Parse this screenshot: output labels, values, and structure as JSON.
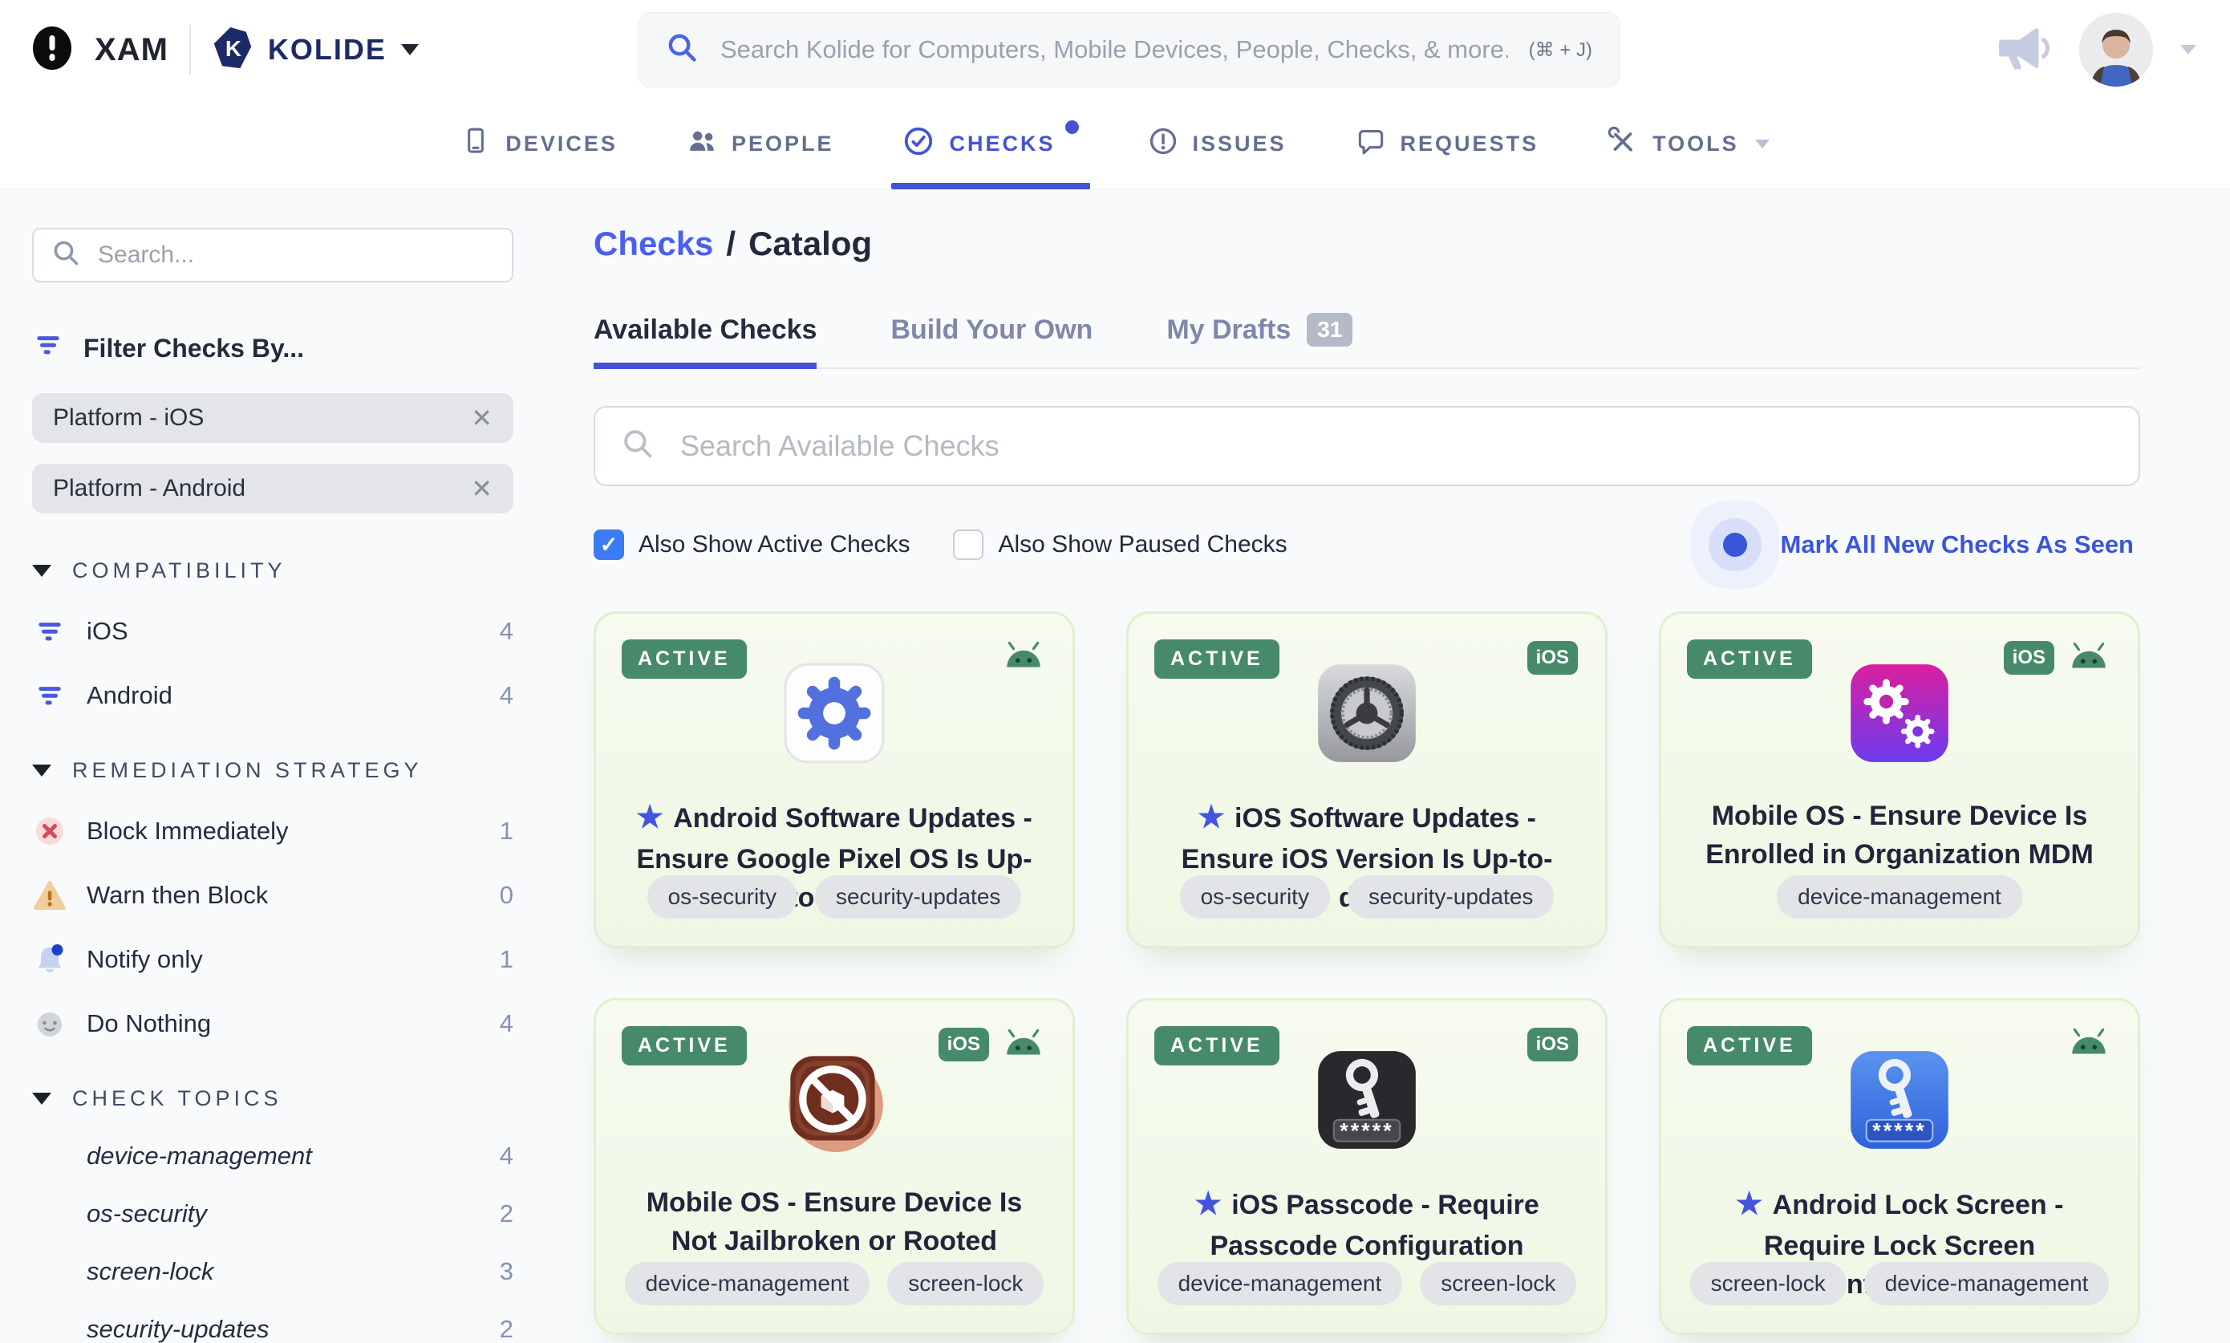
{
  "header": {
    "org": "XAM",
    "brand": "KOLIDE",
    "search_placeholder": "Search Kolide for Computers, Mobile Devices, People, Checks, & more...",
    "search_shortcut": "(⌘ + J)"
  },
  "nav": {
    "items": [
      {
        "label": "DEVICES",
        "icon": "devices",
        "active": false
      },
      {
        "label": "PEOPLE",
        "icon": "people",
        "active": false
      },
      {
        "label": "CHECKS",
        "icon": "checks",
        "active": true,
        "dot": true
      },
      {
        "label": "ISSUES",
        "icon": "issues",
        "active": false
      },
      {
        "label": "REQUESTS",
        "icon": "requests",
        "active": false
      },
      {
        "label": "TOOLS",
        "icon": "tools",
        "active": false,
        "caret": true
      }
    ]
  },
  "sidebar": {
    "search_placeholder": "Search...",
    "filter_title": "Filter Checks By...",
    "chips": [
      {
        "label": "Platform - iOS"
      },
      {
        "label": "Platform - Android"
      }
    ],
    "sections": [
      {
        "title": "COMPATIBILITY",
        "items": [
          {
            "label": "iOS",
            "count": "4",
            "icon": "filter"
          },
          {
            "label": "Android",
            "count": "4",
            "icon": "filter"
          }
        ]
      },
      {
        "title": "REMEDIATION STRATEGY",
        "items": [
          {
            "label": "Block Immediately",
            "count": "1",
            "icon": "block"
          },
          {
            "label": "Warn then Block",
            "count": "0",
            "icon": "warn"
          },
          {
            "label": "Notify only",
            "count": "1",
            "icon": "notify"
          },
          {
            "label": "Do Nothing",
            "count": "4",
            "icon": "nothing"
          }
        ]
      },
      {
        "title": "CHECK TOPICS",
        "items": [
          {
            "label": "device-management",
            "count": "4",
            "italic": true
          },
          {
            "label": "os-security",
            "count": "2",
            "italic": true
          },
          {
            "label": "screen-lock",
            "count": "3",
            "italic": true
          },
          {
            "label": "security-updates",
            "count": "2",
            "italic": true
          }
        ]
      }
    ]
  },
  "main": {
    "breadcrumb": {
      "parent": "Checks",
      "separator": "/",
      "current": "Catalog"
    },
    "tabs": [
      {
        "label": "Available Checks",
        "active": true
      },
      {
        "label": "Build Your Own",
        "active": false
      },
      {
        "label": "My Drafts",
        "active": false,
        "badge": "31"
      }
    ],
    "search_placeholder": "Search Available Checks",
    "filters": [
      {
        "label": "Also Show Active Checks",
        "checked": true
      },
      {
        "label": "Also Show Paused Checks",
        "checked": false
      }
    ],
    "mark_all_label": "Mark All New Checks As Seen",
    "cards": [
      {
        "status": "ACTIVE",
        "platforms": [
          "android"
        ],
        "icon": "android-gear",
        "starred": true,
        "title": "Android Software Updates - Ensure Google Pixel OS Is Up-to-date",
        "tags": [
          "os-security",
          "security-updates"
        ]
      },
      {
        "status": "ACTIVE",
        "platforms": [
          "ios"
        ],
        "icon": "ios-settings",
        "starred": true,
        "title": "iOS Software Updates - Ensure iOS Version Is Up-to-date",
        "tags": [
          "os-security",
          "security-updates"
        ]
      },
      {
        "status": "ACTIVE",
        "platforms": [
          "ios",
          "android"
        ],
        "icon": "mdm-gears",
        "starred": false,
        "title": "Mobile OS - Ensure Device Is Enrolled in Organization MDM",
        "tags": [
          "device-management"
        ]
      },
      {
        "status": "ACTIVE",
        "platforms": [
          "ios",
          "android"
        ],
        "icon": "no-jailbreak",
        "starred": false,
        "title": "Mobile OS - Ensure Device Is Not Jailbroken or Rooted",
        "tags": [
          "device-management",
          "screen-lock"
        ]
      },
      {
        "status": "ACTIVE",
        "platforms": [
          "ios"
        ],
        "icon": "passcode-dark",
        "starred": true,
        "title": "iOS Passcode - Require Passcode Configuration",
        "tags": [
          "device-management",
          "screen-lock"
        ]
      },
      {
        "status": "ACTIVE",
        "platforms": [
          "android"
        ],
        "icon": "passcode-blue",
        "starred": true,
        "title": "Android Lock Screen - Require Lock Screen Configuration",
        "tags": [
          "screen-lock",
          "device-management"
        ]
      }
    ]
  },
  "colors": {
    "accent_blue": "#4254d5",
    "link_blue": "#4b5ef0",
    "active_badge_green": "#478a69",
    "card_green_bg": "#f4fae9",
    "brand_navy": "#1c2b66"
  }
}
